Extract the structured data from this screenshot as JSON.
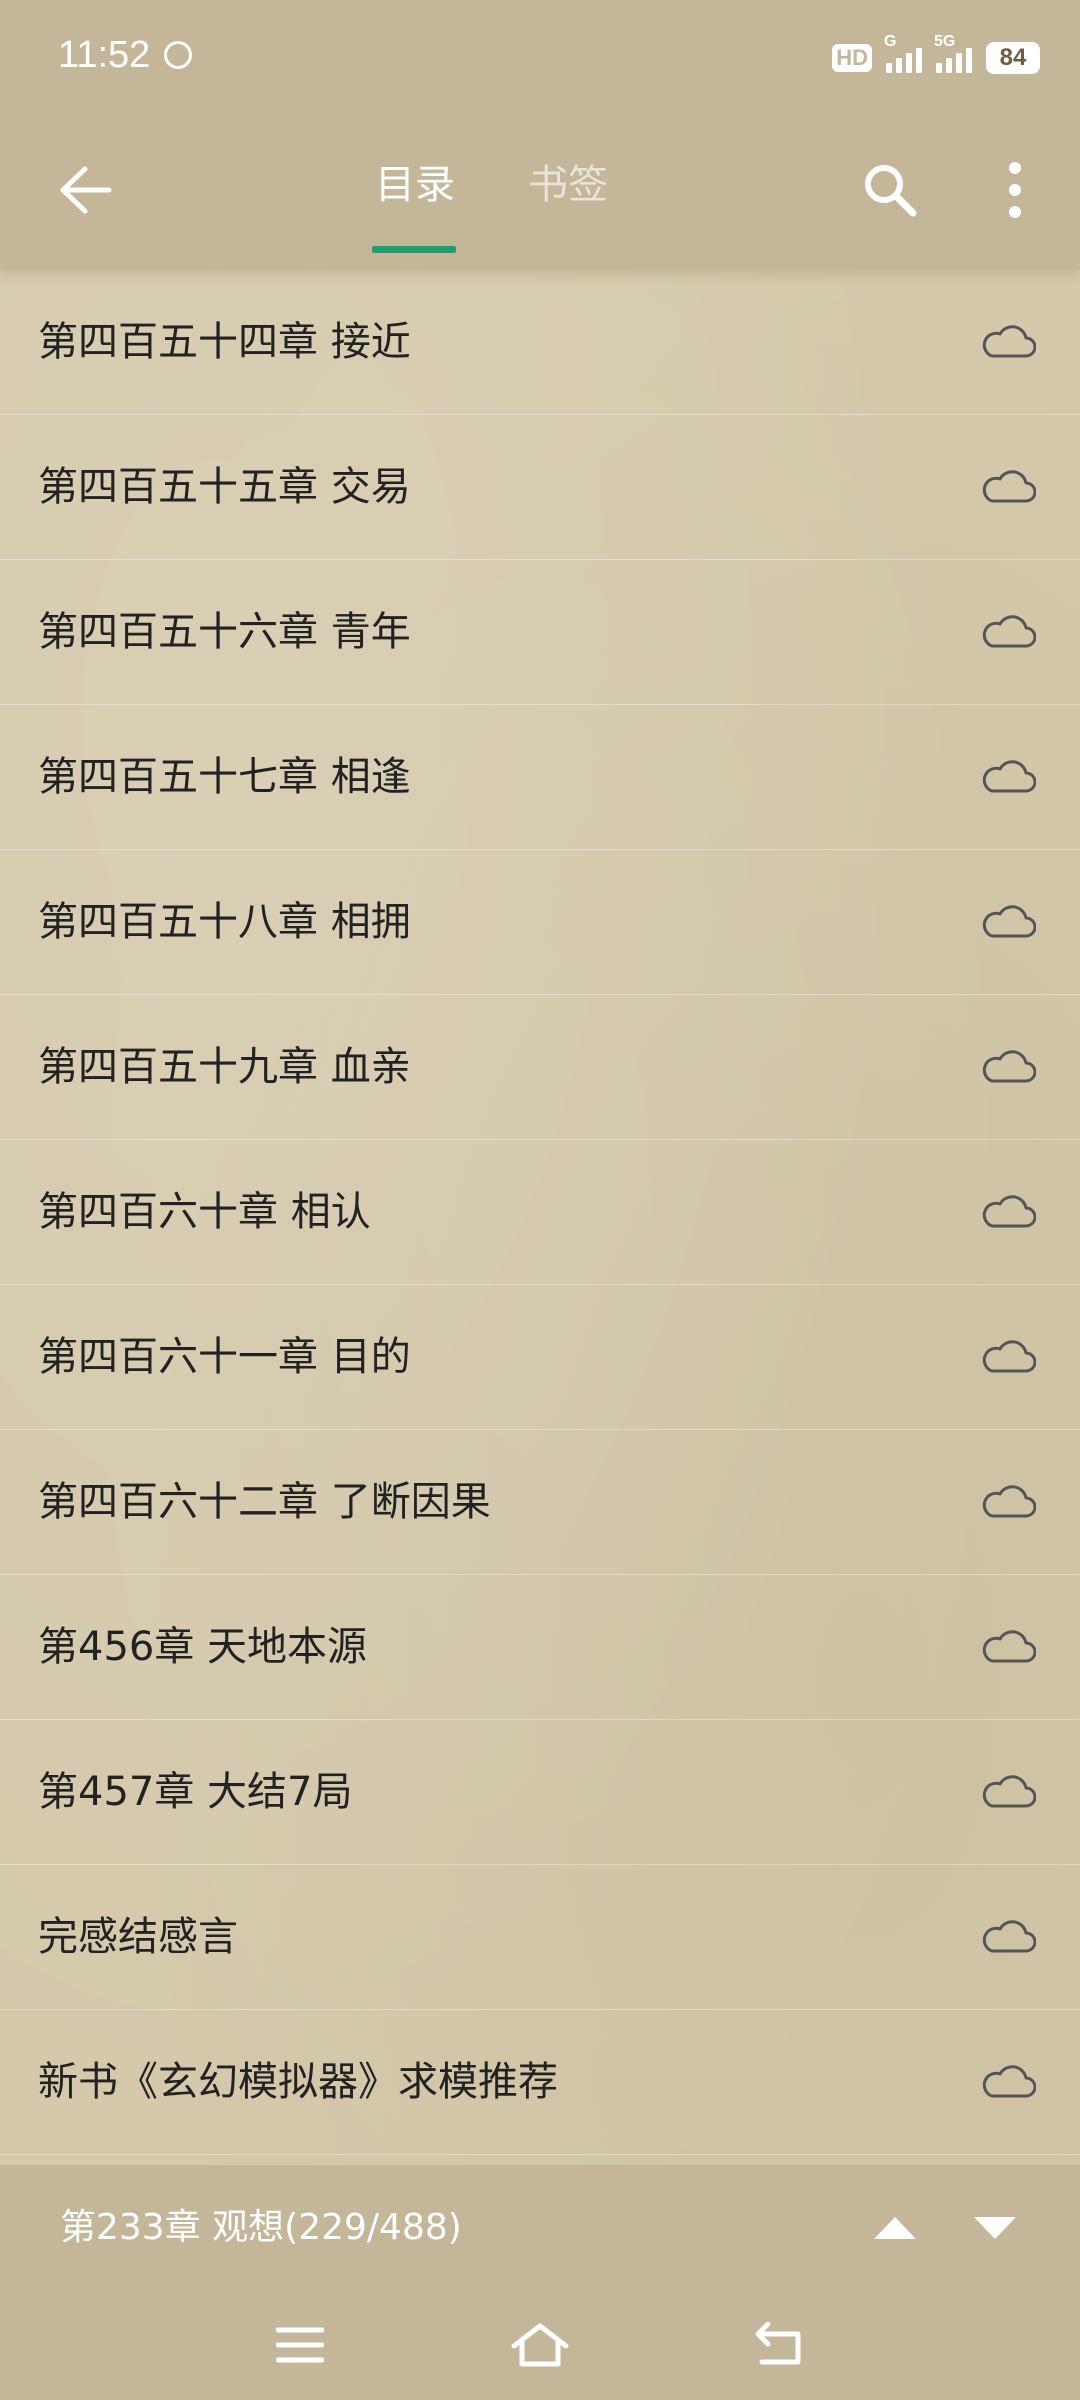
{
  "status_bar": {
    "time": "11:52",
    "hd_label": "HD",
    "network_1": "G",
    "network_2": "5G",
    "battery": "84"
  },
  "nav": {
    "tabs": [
      {
        "label": "目录",
        "active": true
      },
      {
        "label": "书签",
        "active": false
      }
    ],
    "back_icon": "arrow-left-icon",
    "search_icon": "search-icon",
    "more_icon": "more-vertical-icon"
  },
  "chapters": [
    {
      "title": "第四百五十四章 接近",
      "icon": "cloud-icon"
    },
    {
      "title": "第四百五十五章 交易",
      "icon": "cloud-icon"
    },
    {
      "title": "第四百五十六章 青年",
      "icon": "cloud-icon"
    },
    {
      "title": "第四百五十七章 相逢",
      "icon": "cloud-icon"
    },
    {
      "title": "第四百五十八章 相拥",
      "icon": "cloud-icon"
    },
    {
      "title": "第四百五十九章 血亲",
      "icon": "cloud-icon"
    },
    {
      "title": "第四百六十章 相认",
      "icon": "cloud-icon"
    },
    {
      "title": "第四百六十一章 目的",
      "icon": "cloud-icon"
    },
    {
      "title": "第四百六十二章 了断因果",
      "icon": "cloud-icon"
    },
    {
      "title": "第456章 天地本源",
      "icon": "cloud-icon"
    },
    {
      "title": "第457章 大结7局",
      "icon": "cloud-icon"
    },
    {
      "title": "完感结感言",
      "icon": "cloud-icon"
    },
    {
      "title": "新书《玄幻模拟器》求模推荐",
      "icon": "cloud-icon"
    }
  ],
  "bottom_bar": {
    "current_chapter": "第233章 观想(229/488)",
    "up_icon": "triangle-up-icon",
    "down_icon": "triangle-down-icon"
  },
  "system_nav": {
    "menu_icon": "menu-icon",
    "home_icon": "home-icon",
    "back_icon": "back-icon"
  },
  "colors": {
    "header_bg": "#c4b698",
    "page_bg": "#d4c9ab",
    "accent": "#1f9e72",
    "text": "#222222"
  }
}
